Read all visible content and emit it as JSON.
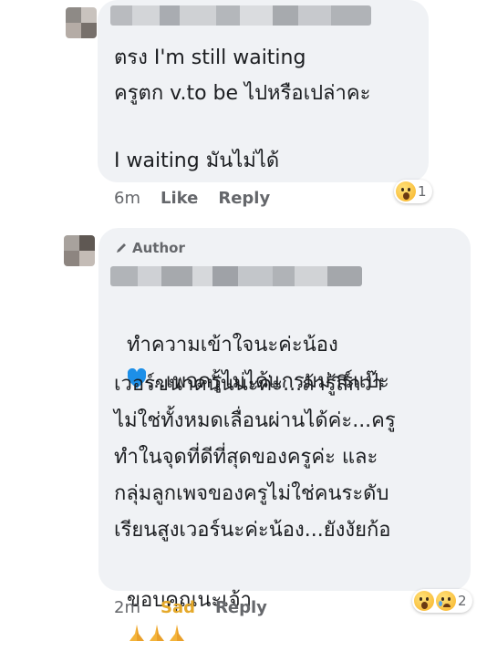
{
  "comment1": {
    "line1": "ตรง I'm still waiting",
    "line2": "ครูตก v.to be ไปหรือเปล่าคะ",
    "line3": "I waiting มันไม่ได้",
    "time": "6m",
    "like_label": "Like",
    "reply_label": "Reply",
    "reaction_icon": "wow-icon",
    "reaction_count": "1"
  },
  "comment2": {
    "badge_icon": "pencil-icon",
    "badge_label": "Author",
    "line1": "ทำความเข้าใจนะค่ะน้อง",
    "line2": "...เพจครูไม่ได้แกรมม่าร์แป๊ะ",
    "line3": "เวอร์ขนาดนั้นนะค่ะ...ถ้ารู้สึกว่า",
    "line4": "ไม่ใช่ทั้งหมดเลื่อนผ่านได้ค่ะ...ครู",
    "line5": "ทำในจุดที่ดีที่สุดของครูค่ะ และ",
    "line6": "กลุ่มลูกเพจของครูไม่ใช่คนระดับ",
    "line7": "เรียนสูงเวอร์นะค่ะน้อง...ยังงัยก้อ",
    "line8": "ขอบคุณนะเจ้า",
    "heart_color": "#1d8fe8",
    "time": "2m",
    "sad_label": "Sad",
    "sad_color": "#e5a92a",
    "reply_label": "Reply",
    "reaction_icons": [
      "wow-icon",
      "sad-icon"
    ],
    "reaction_count": "2"
  }
}
